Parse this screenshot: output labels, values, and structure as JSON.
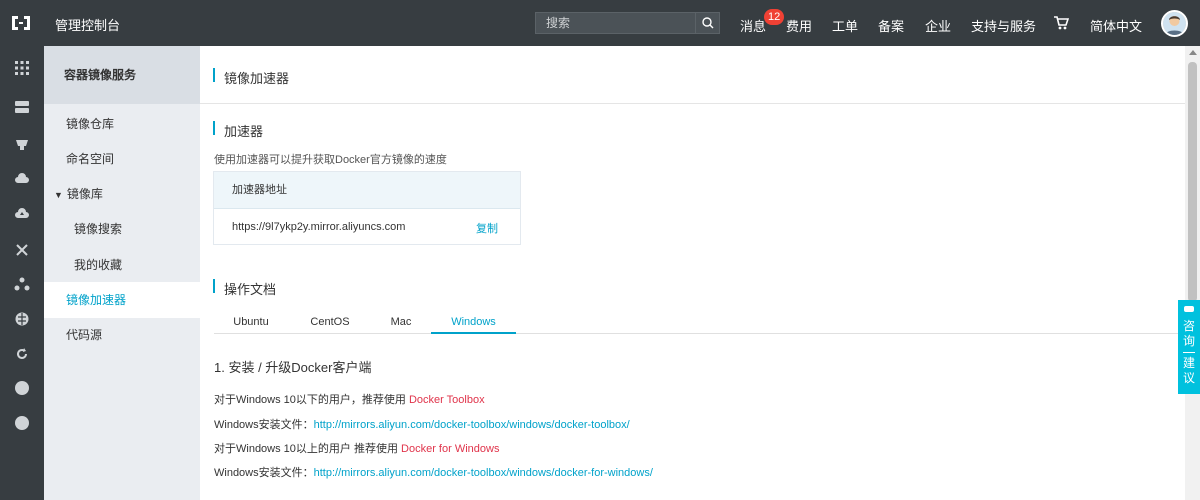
{
  "topbar": {
    "logo_icon": "aliyun-logo-icon",
    "title": "管理控制台",
    "search": {
      "placeholder": "搜索",
      "icon": "search-icon"
    },
    "nav": {
      "messages": "消息",
      "messages_count": "12",
      "fees": "费用",
      "tickets": "工单",
      "icp": "备案",
      "enterprise": "企业",
      "support": "支持与服务",
      "cart_icon": "cart-icon",
      "language": "简体中文"
    }
  },
  "rail": {
    "icons": [
      "grid-icon",
      "server-icon",
      "database-icon",
      "cloud-icon",
      "cloud-upload-icon",
      "network-icon",
      "nodes-icon",
      "globe-icon",
      "refresh-icon",
      "circle-icon",
      "circle-icon"
    ]
  },
  "subnav": {
    "title": "容器镜像服务",
    "items": [
      {
        "label": "镜像仓库"
      },
      {
        "label": "命名空间"
      },
      {
        "label": "镜像库",
        "expanded": true
      },
      {
        "label": "镜像搜索"
      },
      {
        "label": "我的收藏"
      },
      {
        "label": "镜像加速器",
        "active": true
      },
      {
        "label": "代码源"
      }
    ]
  },
  "main": {
    "page_title": "镜像加速器",
    "accelerator": {
      "title": "加速器",
      "description": "使用加速器可以提升获取Docker官方镜像的速度",
      "box_header": "加速器地址",
      "url": "https://9l7ykp2y.mirror.aliyuncs.com",
      "copy": "复制"
    },
    "docs": {
      "title": "操作文档",
      "tabs": [
        "Ubuntu",
        "CentOS",
        "Mac",
        "Windows"
      ],
      "active_tab": "Windows",
      "step_title": "1. 安装 / 升级Docker客户端",
      "line1_text": "对于Windows 10以下的用户，推荐使用 ",
      "line1_link": "Docker Toolbox",
      "line2_text": "Windows安装文件：",
      "line2_link": "http://mirrors.aliyun.com/docker-toolbox/windows/docker-toolbox/",
      "line3_text": "对于Windows 10以上的用户 推荐使用 ",
      "line3_link": "Docker for Windows",
      "line4_text": "Windows安装文件：",
      "line4_link": "http://mirrors.aliyun.com/docker-toolbox/windows/docker-for-windows/"
    }
  },
  "float_button": {
    "label_top": "咨询",
    "label_bottom": "建议",
    "icon": "chat-icon"
  },
  "colors": {
    "topbar": "#373d41",
    "accent": "#00a2ca",
    "link_red": "#e0344b",
    "float": "#00c1de"
  }
}
